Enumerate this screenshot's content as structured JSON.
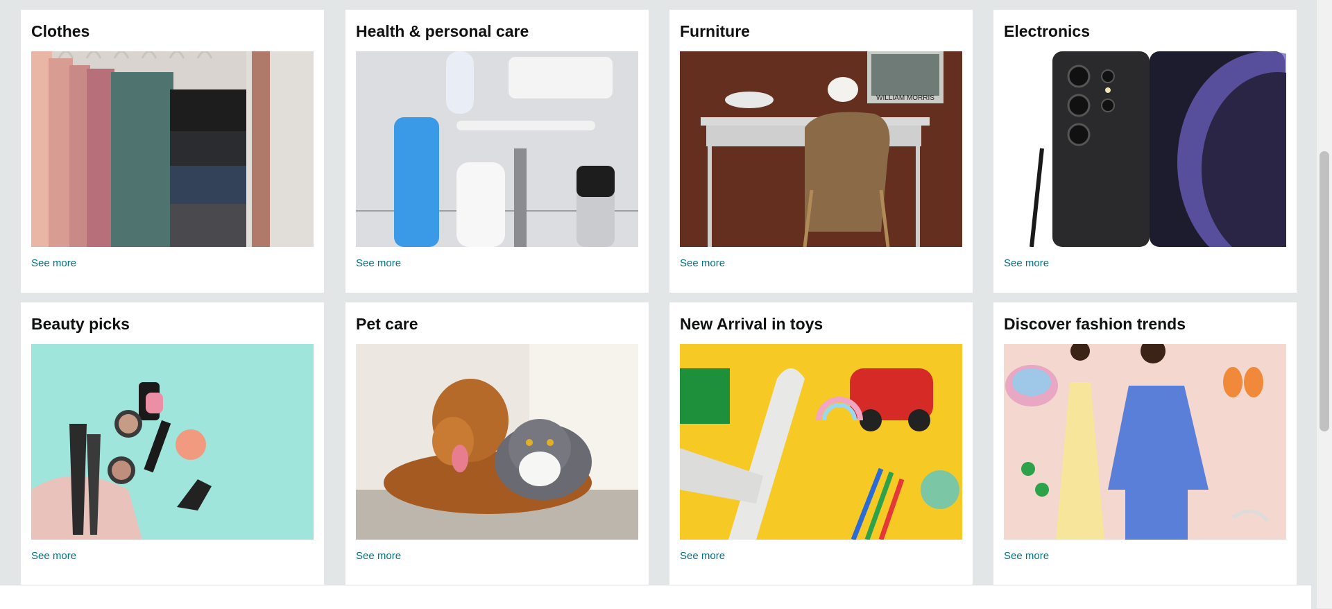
{
  "cards": [
    {
      "title": "Clothes",
      "link": "See more",
      "image": "clothes-hangers-image"
    },
    {
      "title": "Health & personal care",
      "link": "See more",
      "image": "personal-care-products-image"
    },
    {
      "title": "Furniture",
      "link": "See more",
      "image": "desk-and-chair-image"
    },
    {
      "title": "Electronics",
      "link": "See more",
      "image": "smartphone-with-stylus-image"
    },
    {
      "title": "Beauty picks",
      "link": "See more",
      "image": "makeup-brushes-image"
    },
    {
      "title": "Pet care",
      "link": "See more",
      "image": "dog-and-cat-image"
    },
    {
      "title": "New Arrival in toys",
      "link": "See more",
      "image": "toys-on-yellow-image"
    },
    {
      "title": "Discover fashion trends",
      "link": "See more",
      "image": "fashion-models-image"
    }
  ],
  "poster_text": "WILLIAM MORRIS",
  "colors": {
    "link": "#007185",
    "page_bg": "#e3e6e6",
    "card_bg": "#ffffff",
    "title": "#0f1111"
  }
}
